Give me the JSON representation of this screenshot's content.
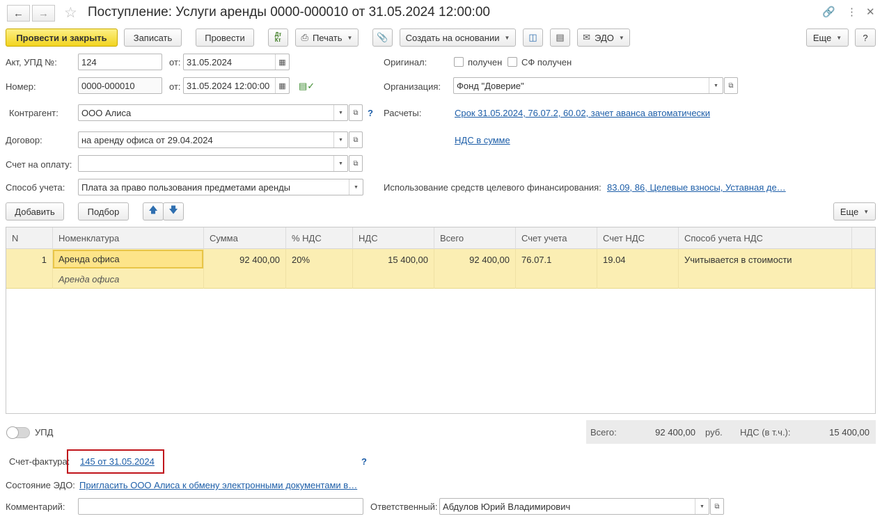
{
  "header": {
    "back_icon": "arrow-left-icon",
    "forward_icon": "arrow-right-icon",
    "favorite_icon": "star-icon",
    "title": "Поступление: Услуги аренды 0000-000010 от 31.05.2024 12:00:00",
    "link_icon": "link-icon",
    "more_icon": "vertical-dots-icon",
    "close_icon": "close-icon"
  },
  "toolbar": {
    "post_close": "Провести и закрыть",
    "save": "Записать",
    "post": "Провести",
    "dtkt_icon": "dt-kt-icon",
    "print": "Печать",
    "attach_icon": "paperclip-icon",
    "create_based": "Создать на основании",
    "structure_icon": "structure-icon",
    "report_icon": "report-icon",
    "edo": "ЭДО",
    "more": "Еще",
    "help": "?"
  },
  "form": {
    "act_label": "Акт, УПД №:",
    "act_number": "124",
    "from_label": "от:",
    "act_date": "31.05.2024",
    "number_label": "Номер:",
    "number": "0000-000010",
    "number_date": "31.05.2024 12:00:00",
    "original_label": "Оригинал:",
    "received_label": "получен",
    "sf_received_label": "СФ получен",
    "org_label": "Организация:",
    "org_value": "Фонд \"Доверие\"",
    "counterparty_label": "Контрагент:",
    "counterparty_value": "ООО Алиса",
    "help_q": "?",
    "settlements_label": "Расчеты:",
    "settlements_link": "Срок 31.05.2024, 76.07.2, 60.02, зачет аванса автоматически",
    "contract_label": "Договор:",
    "contract_value": "на аренду офиса от 29.04.2024",
    "vat_link": "НДС в сумме",
    "invoice_label": "Счет на оплату:",
    "invoice_value": "",
    "method_label": "Способ учета:",
    "method_value": "Плата за право пользования предметами аренды",
    "funding_label": "Использование средств целевого финансирования:",
    "funding_link": "83.09, 86, Целевые взносы, Уставная де…"
  },
  "table_toolbar": {
    "add": "Добавить",
    "pick": "Подбор",
    "up_icon": "arrow-up-icon",
    "down_icon": "arrow-down-icon",
    "more": "Еще"
  },
  "table": {
    "columns": [
      "N",
      "Номенклатура",
      "Сумма",
      "% НДС",
      "НДС",
      "Всего",
      "Счет учета",
      "Счет НДС",
      "Способ учета НДС"
    ],
    "rows": [
      {
        "n": "1",
        "nomenclature": "Аренда офиса",
        "content": "Аренда офиса",
        "sum": "92 400,00",
        "vat_rate": "20%",
        "vat": "15 400,00",
        "total": "92 400,00",
        "account": "76.07.1",
        "vat_account": "19.04",
        "vat_method": "Учитывается в стоимости"
      }
    ]
  },
  "footer": {
    "upd_label": "УПД",
    "total_label": "Всего:",
    "total_value": "92 400,00",
    "currency": "руб.",
    "vat_label": "НДС (в т.ч.):",
    "vat_value": "15 400,00",
    "invoice_label": "Счет-фактура:",
    "invoice_link": "145 от 31.05.2024",
    "help_q": "?",
    "edo_label": "Состояние ЭДО:",
    "edo_link": "Пригласить ООО Алиса к обмену электронными документами в…",
    "comment_label": "Комментарий:",
    "comment_value": "",
    "responsible_label": "Ответственный:",
    "responsible_value": "Абдулов Юрий Владимирович"
  }
}
